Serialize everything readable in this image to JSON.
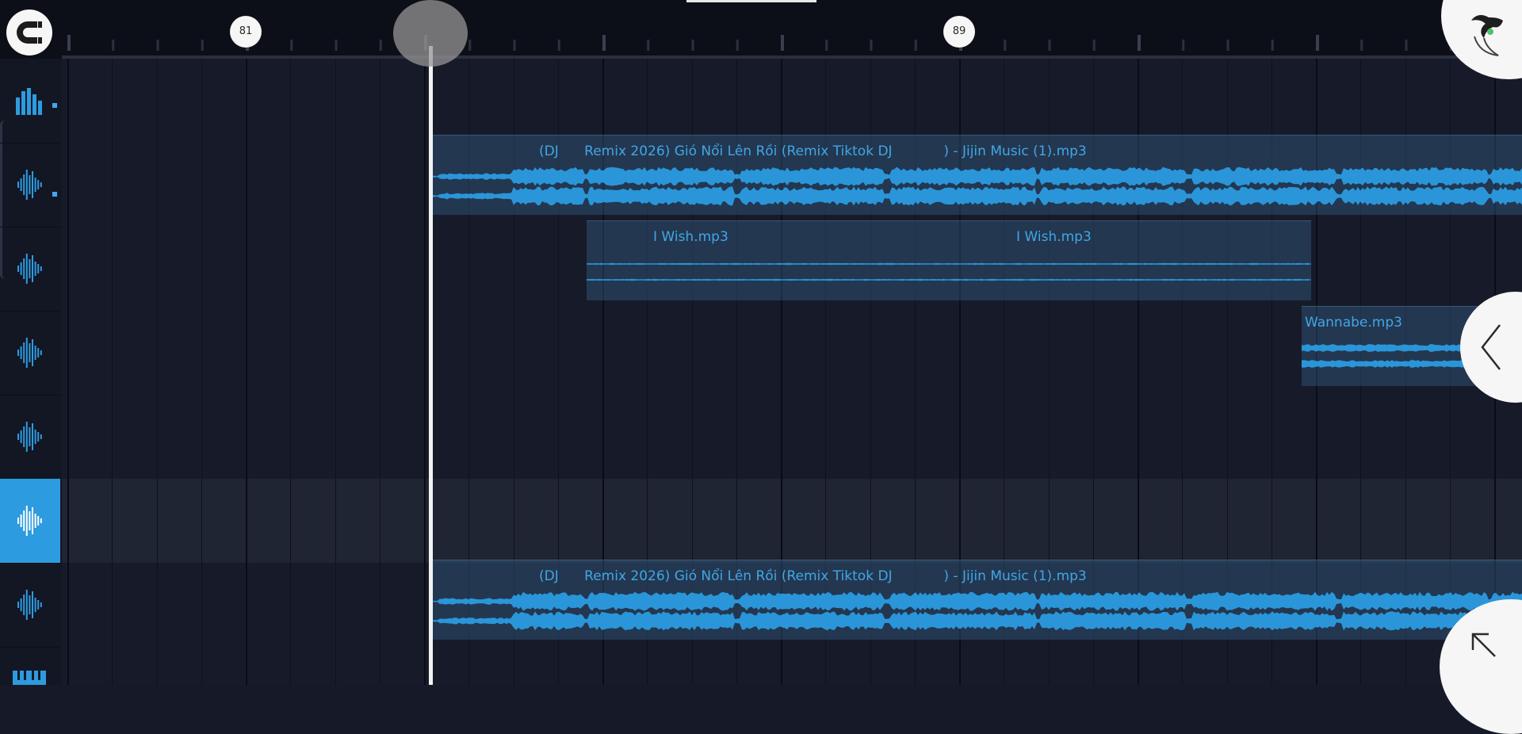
{
  "ruler": {
    "bar_markers": [
      {
        "label": "81"
      },
      {
        "label": "89"
      }
    ]
  },
  "tracks": [
    {
      "icon": "mixer-icon",
      "selected": false
    },
    {
      "icon": "waveform-icon",
      "selected": false
    },
    {
      "icon": "waveform-icon",
      "selected": false
    },
    {
      "icon": "waveform-icon",
      "selected": false
    },
    {
      "icon": "waveform-icon",
      "selected": false
    },
    {
      "icon": "waveform-icon",
      "selected": true
    },
    {
      "icon": "waveform-icon",
      "selected": false
    }
  ],
  "clips": [
    {
      "label": "(DJ      Remix 2026) Gió Nổi Lên Rồi (Remix Tiktok DJ            ) - Jijin Music (1).mp3"
    },
    {
      "label": "I Wish.mp3",
      "label_repeat": "I Wish.mp3"
    },
    {
      "label": "Wannabe.mp3"
    },
    {
      "label": "(DJ      Remix 2026) Gió Nổi Lên Rồi (Remix Tiktok DJ            ) - Jijin Music (1).mp3"
    }
  ],
  "colors": {
    "accent": "#2d9be0",
    "clip_text": "#41a6e4",
    "waveform": "#2b9be0",
    "background": "#161a28",
    "ruler": "#0d0f18"
  },
  "icons": {
    "snap": "magnet-icon",
    "logo": "fl-studio-fruit-icon",
    "collapse": "chevron-left-icon",
    "expand": "arrow-up-left-icon",
    "bottom": "piano-keys-icon"
  }
}
